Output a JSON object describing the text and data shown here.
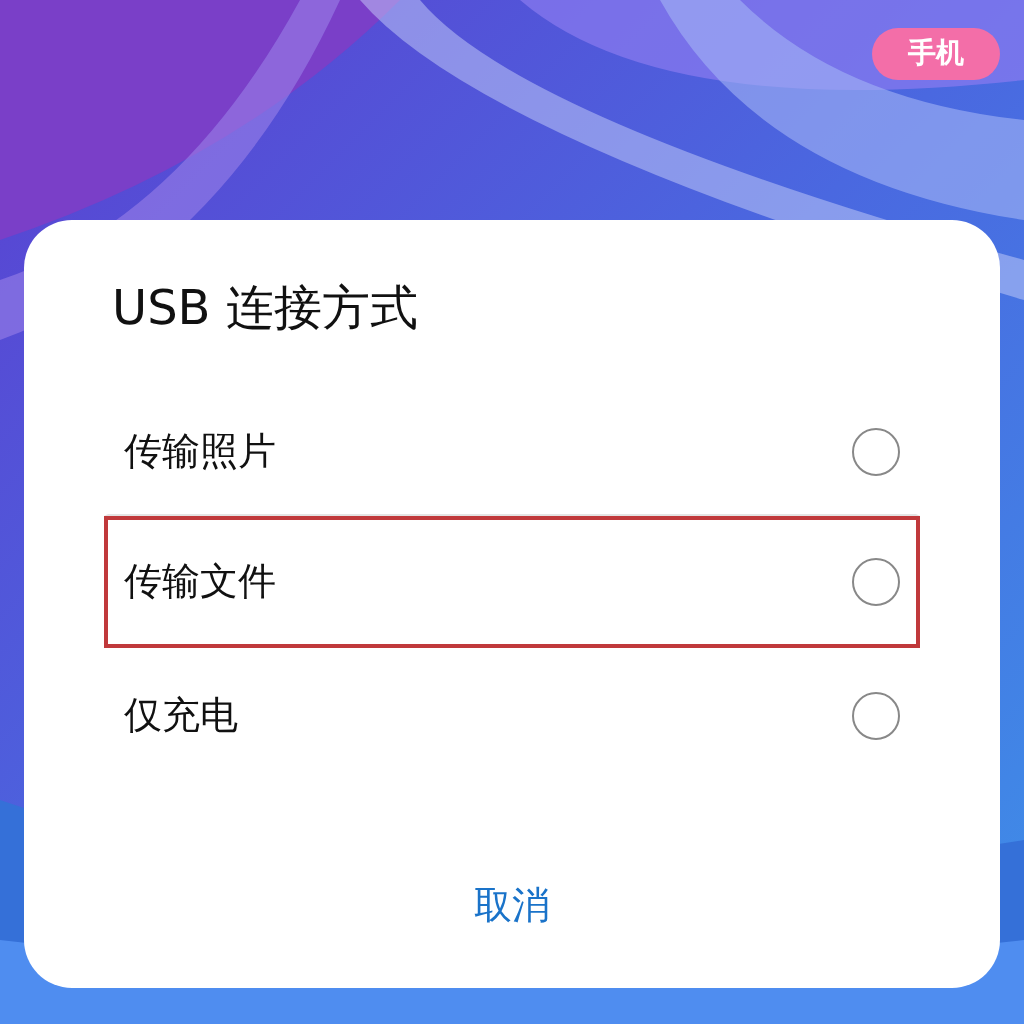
{
  "badge": {
    "label": "手机"
  },
  "dialog": {
    "title": "USB 连接方式",
    "options": [
      {
        "label": "传输照片",
        "selected": false,
        "highlighted": false
      },
      {
        "label": "传输文件",
        "selected": false,
        "highlighted": true
      },
      {
        "label": "仅充电",
        "selected": false,
        "highlighted": false
      }
    ],
    "cancel_button": "取消"
  }
}
